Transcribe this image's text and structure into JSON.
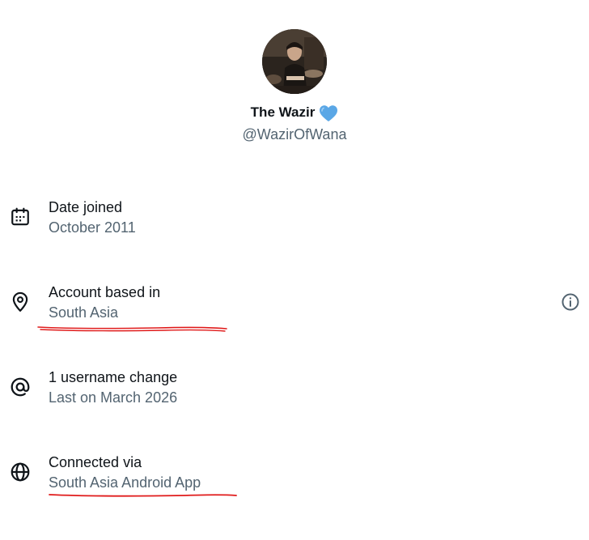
{
  "profile": {
    "display_name": "The Wazir",
    "handle": "@WazirOfWana",
    "avatar_icon": "profile-photo",
    "badge_icon": "blue-heart-emoji"
  },
  "info_rows": [
    {
      "icon": "calendar-icon",
      "label": "Date joined",
      "value": "October 2011"
    },
    {
      "icon": "location-pin-icon",
      "label": "Account based in",
      "value": "South Asia"
    },
    {
      "icon": "at-sign-icon",
      "label": "1 username change",
      "value": "Last on March 2026"
    },
    {
      "icon": "globe-icon",
      "label": "Connected via",
      "value": "South Asia Android App"
    }
  ],
  "colors": {
    "primary_text": "#0f1419",
    "secondary_text": "#536471",
    "heart": "#5aa7e6",
    "annotation_underline": "#e01b1b"
  }
}
